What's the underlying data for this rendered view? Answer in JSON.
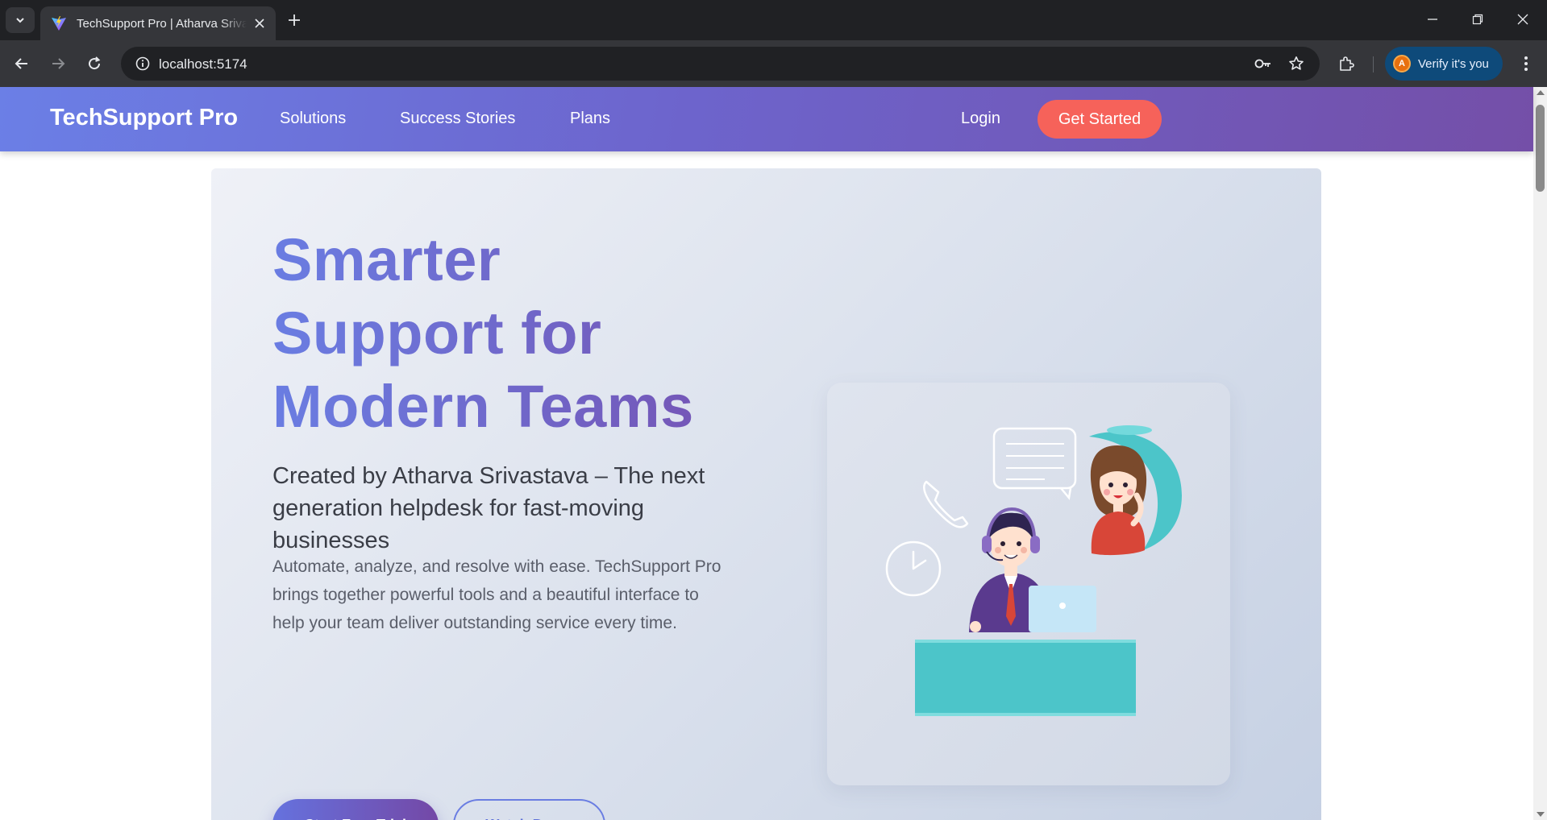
{
  "browser": {
    "tab_title": "TechSupport Pro | Atharva Srivastava",
    "url": "localhost:5174",
    "verify_label": "Verify it's you",
    "avatar_initial": "A"
  },
  "nav": {
    "brand": "TechSupport Pro",
    "links": [
      "Solutions",
      "Success Stories",
      "Plans"
    ],
    "login": "Login",
    "cta": "Get Started"
  },
  "hero": {
    "title_lines": [
      "Smarter",
      "Support for",
      "Modern Teams"
    ],
    "subtitle": "Created by Atharva Srivastava – The next generation helpdesk for fast-moving businesses",
    "body": "Automate, analyze, and resolve with ease. TechSupport Pro brings together powerful tools and a beautiful interface to help your team deliver outstanding service every time.",
    "primary_button": "Start Free Trial",
    "secondary_button": "Watch Demo"
  },
  "colors": {
    "nav_gradient_start": "#6b7fe6",
    "nav_gradient_end": "#744fa8",
    "cta": "#f6625a",
    "title_gradient_start": "#6a7de2",
    "title_gradient_end": "#7650b0",
    "teal": "#4cc5c9"
  },
  "icons": [
    "tab-search-icon",
    "vite-favicon-icon",
    "close-icon",
    "plus-icon",
    "minimize-icon",
    "restore-icon",
    "window-close-icon",
    "back-arrow-icon",
    "forward-arrow-icon",
    "reload-icon",
    "info-icon",
    "password-key-icon",
    "bookmark-star-icon",
    "extensions-icon",
    "more-vert-icon"
  ]
}
